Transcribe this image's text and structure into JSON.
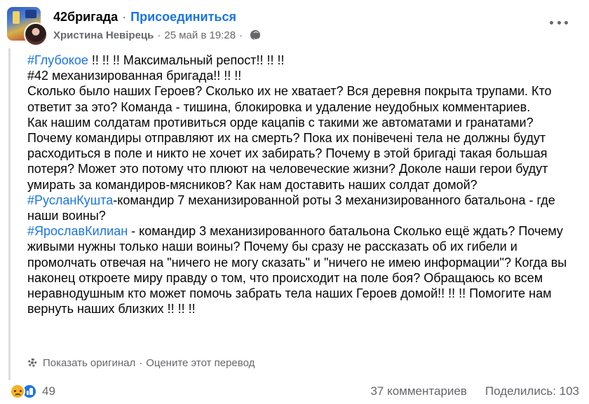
{
  "header": {
    "group_name": "42бригада",
    "separator": "·",
    "join_label": "Присоединиться",
    "author": "Христина Невірець",
    "timestamp": "25 май в 19:28",
    "audience_icon": "globe-icon",
    "more_icon": "more-options-icon"
  },
  "post": {
    "lines": [
      {
        "tag": "#Глубокое",
        "text": " !!   !! !! Максимальный репост!!   !! !!"
      },
      {
        "tag": "",
        "text": "#42 механизированная бригада!! !! !!"
      },
      {
        "tag": "",
        "text": "Сколько было наших Героев? Сколько их не хватает? Вся деревня покрыта трупами. Кто ответит за это? Команда - тишина, блокировка и удаление неудобных комментариев."
      },
      {
        "tag": "",
        "text": "Как нашим солдатам противиться орде кацапів с такими же автоматами и гранатами? Почему командиры отправляют их на смерть? Пока их понівечені тела не должны будут расходиться в поле и никто не хочет их забирать? Почему в этой бригаді такая большая потеря? Может это потому что плюют на человеческие жизни? Доколе наши герои будут умирать за командиров-мясников? Как нам доставить наших солдат домой?"
      },
      {
        "tag": "#РусланКушта",
        "text": "-командир 7 механизированной роты 3 механизированного батальона - где наши воины?"
      },
      {
        "tag": "#ЯрославКилиан",
        "text": " - командир 3 механизированного батальона Сколько ещё ждать? Почему живыми нужны только наши воины? Почему бы сразу не рассказать об их гибели и промолчать отвечая на \"ничего не могу сказать\" и \"ничего не имею информации\"? Когда вы наконец откроете миру правду о том, что происходит на поле боя? Обращаюсь ко всем неравнодушным кто может помочь забрать тела наших Героев домой!! !! !!  Помогите нам вернуть наших близких !! !! !!"
      }
    ]
  },
  "translation": {
    "icon": "gear-icon",
    "show_original": "Показать оригинал",
    "separator": "·",
    "rate_translation": "Оцените этот перевод"
  },
  "footer": {
    "reaction_icons": [
      "sad-reaction-icon",
      "like-reaction-icon"
    ],
    "reaction_count": "49",
    "comments": "37 комментариев",
    "shares": "Поделились: 103"
  },
  "colors": {
    "link_blue": "#1b74e4",
    "text": "#050505",
    "secondary": "#65676b"
  }
}
